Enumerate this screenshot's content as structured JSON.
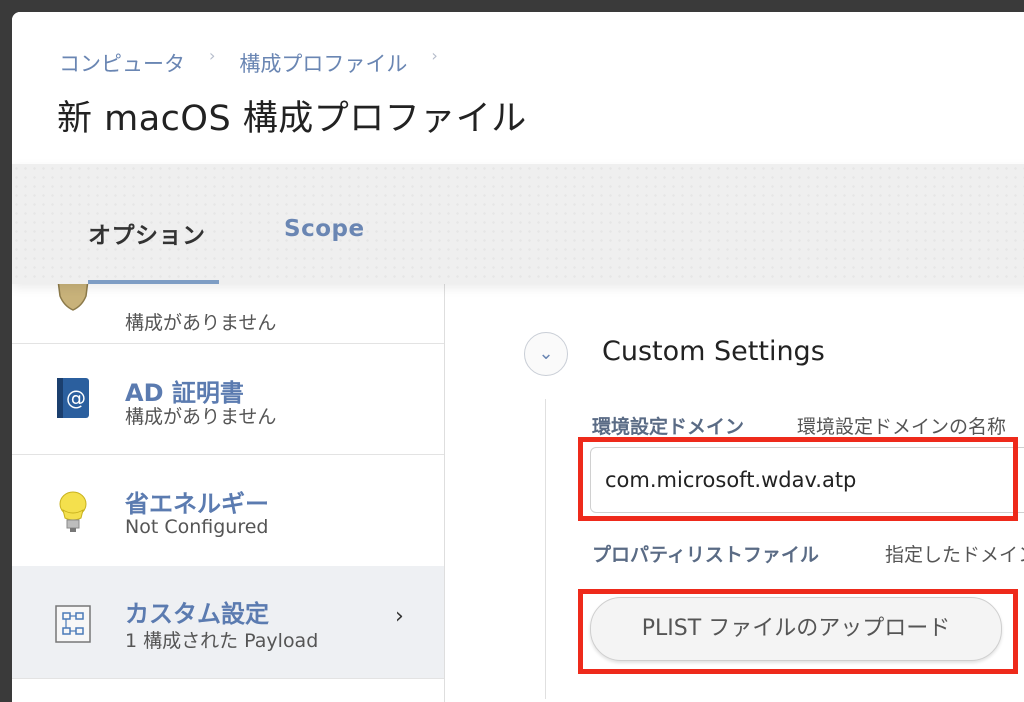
{
  "breadcrumb": {
    "item1": "コンピュータ",
    "sep": "›",
    "item2": "構成プロファイル",
    "sep2": "›"
  },
  "page_title": "新 macOS 構成プロファイル",
  "tabs": {
    "options": "オプション",
    "scope": "Scope"
  },
  "sidebar": {
    "items": [
      {
        "label": "",
        "sub": "構成がありません"
      },
      {
        "label": "AD 証明書",
        "sub": "構成がありません"
      },
      {
        "label": "省エネルギー",
        "sub": "Not Configured"
      },
      {
        "label": "カスタム設定",
        "sub": "1 構成された Payload",
        "chevron": "›"
      }
    ]
  },
  "main": {
    "collapse_icon": "⌄",
    "section_title": "Custom Settings",
    "domain_label": "環境設定ドメイン",
    "domain_hint": "環境設定ドメインの名称",
    "domain_value": "com.microsoft.wdav.atp",
    "plist_label": "プロパティリストファイル",
    "plist_hint": "指定したドメイン",
    "upload_button": "PLIST ファイルのアップロード"
  },
  "colors": {
    "accent": "#6a86b3",
    "highlight": "#ee2a1b",
    "active_row": "#eef0f3"
  }
}
